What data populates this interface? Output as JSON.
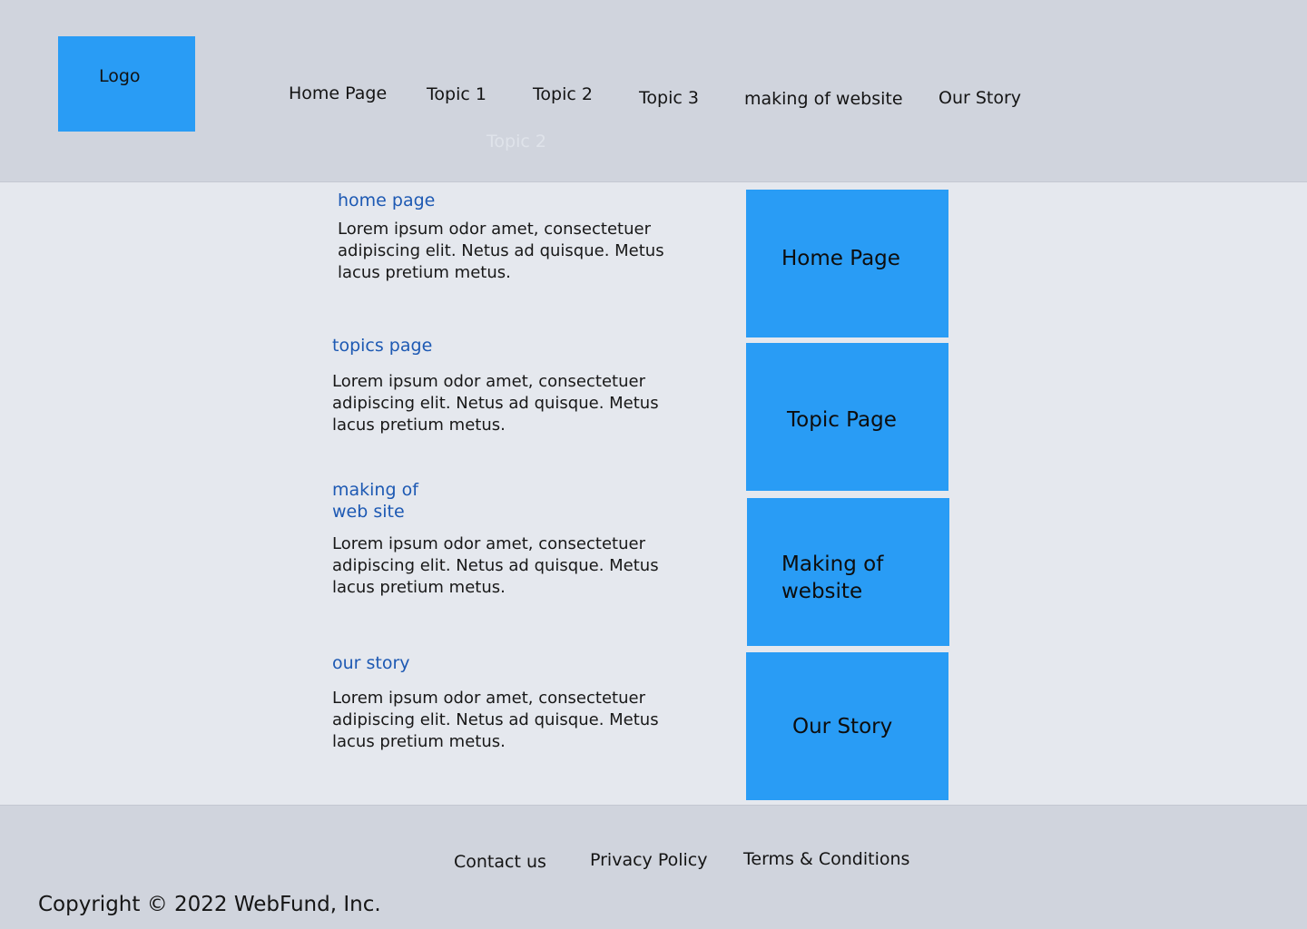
{
  "header": {
    "logo_label": "Logo",
    "nav": [
      "Home Page",
      "Topic 1",
      "Topic 2",
      "Topic 3",
      "making of website",
      "Our Story"
    ],
    "ghost_label": "Topic 2"
  },
  "sections": [
    {
      "heading": "home page",
      "text": "Lorem ipsum odor amet, consectetuer adipiscing elit. Netus ad quisque. Metus lacus pretium metus."
    },
    {
      "heading": "topics page",
      "text": "Lorem ipsum odor amet, consectetuer adipiscing elit. Netus ad quisque. Metus lacus pretium metus."
    },
    {
      "heading": "making of\nweb site",
      "text": "Lorem ipsum odor amet, consectetuer adipiscing elit. Netus ad quisque. Metus lacus pretium metus."
    },
    {
      "heading": "our story",
      "text": "Lorem ipsum odor amet, consectetuer adipiscing elit. Netus ad quisque. Metus lacus pretium metus."
    }
  ],
  "cards": [
    "Home Page",
    "Topic Page",
    "Making of\nwebsite",
    "Our Story"
  ],
  "footer": {
    "links": [
      "Contact us",
      "Privacy Policy",
      "Terms & Conditions"
    ],
    "copyright": "Copyright © 2022 WebFund, Inc."
  },
  "colors": {
    "accent": "#299cf5",
    "header_bg": "#d0d4dd",
    "body_bg": "#e5e8ee",
    "link_blue": "#1d59b3"
  }
}
